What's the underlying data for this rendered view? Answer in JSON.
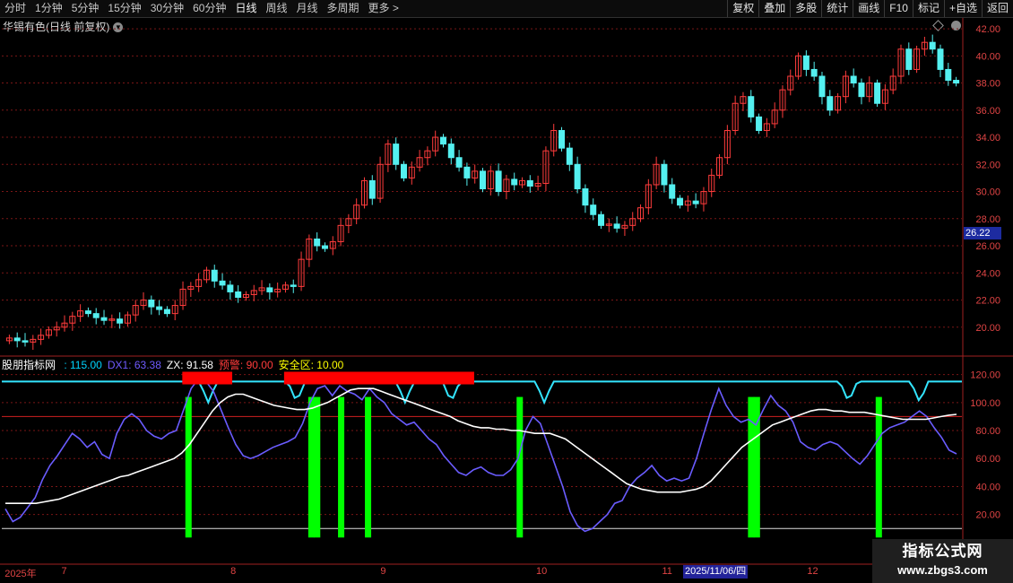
{
  "toolbar": {
    "periods": [
      "分时",
      "1分钟",
      "5分钟",
      "15分钟",
      "30分钟",
      "60分钟",
      "日线",
      "周线",
      "月线",
      "多周期",
      "更多 >"
    ],
    "active_period": "日线",
    "actions": [
      "复权",
      "叠加",
      "多股",
      "统计",
      "画线",
      "F10",
      "标记",
      "+自选",
      "返回"
    ]
  },
  "main": {
    "title": "华锡有色(日线 前复权)",
    "price_tag": "26.22"
  },
  "indicator": {
    "name": "股朋指标网",
    "fields": [
      {
        "label": ": 115.00",
        "color": "#00d4ff"
      },
      {
        "label": "DX1: 63.38",
        "color": "#6f5bff"
      },
      {
        "label": "ZX: 91.58",
        "color": "#ffffff"
      },
      {
        "label": "预警: 90.00",
        "color": "#ff3b3b"
      },
      {
        "label": "安全区: 10.00",
        "color": "#ffff00"
      }
    ]
  },
  "dates": {
    "labels": [
      {
        "text": "2025年",
        "pos": 0.003
      },
      {
        "text": "7",
        "pos": 0.062
      },
      {
        "text": "8",
        "pos": 0.238
      },
      {
        "text": "9",
        "pos": 0.394
      },
      {
        "text": "10",
        "pos": 0.556
      },
      {
        "text": "11",
        "pos": 0.687
      },
      {
        "text": "12",
        "pos": 0.838
      }
    ],
    "cursor_date": "2025/11/06/四"
  },
  "watermark": {
    "title": "指标公式网",
    "url": "www.zbgs3.com"
  },
  "colors": {
    "up": "#ff3c3c",
    "down": "#54f0f0",
    "dx1": "#6a5cff",
    "zx": "#ffffff",
    "line115": "#33e5ff",
    "signal": "#00ff00",
    "alert": "#ff0000"
  },
  "chart_data": [
    {
      "type": "candlestick",
      "title": "华锡有色(日线 前复权)",
      "y_ticks": [
        20.0,
        22.0,
        24.0,
        26.0,
        28.0,
        30.0,
        32.0,
        34.0,
        36.0,
        38.0,
        40.0,
        42.0
      ],
      "ylim": [
        18.0,
        42.6
      ],
      "close": [
        19.2,
        19.0,
        18.9,
        19.1,
        19.4,
        19.8,
        20.0,
        20.3,
        20.8,
        21.2,
        21.0,
        20.7,
        20.5,
        20.6,
        20.3,
        20.9,
        21.6,
        22.0,
        21.5,
        21.3,
        21.0,
        21.6,
        22.8,
        23.0,
        23.5,
        24.2,
        23.4,
        23.1,
        22.6,
        22.2,
        22.4,
        22.7,
        22.9,
        22.6,
        22.8,
        23.1,
        23.0,
        25.0,
        26.5,
        26.0,
        25.8,
        26.3,
        27.5,
        28.0,
        29.0,
        30.8,
        29.5,
        32.0,
        33.5,
        32.0,
        31.0,
        31.8,
        32.5,
        33.0,
        34.0,
        33.5,
        32.5,
        31.8,
        31.0,
        31.5,
        30.2,
        31.5,
        30.0,
        30.9,
        30.5,
        30.8,
        30.4,
        30.6,
        33.0,
        34.5,
        33.2,
        32.0,
        30.2,
        29.0,
        28.3,
        27.5,
        27.6,
        27.3,
        27.5,
        28.0,
        28.8,
        30.5,
        32.0,
        30.5,
        29.5,
        29.0,
        29.3,
        29.1,
        30.0,
        31.2,
        32.5,
        34.5,
        36.5,
        37.0,
        35.5,
        34.5,
        35.0,
        36.0,
        37.5,
        38.5,
        40.0,
        39.0,
        38.5,
        37.0,
        36.0,
        37.0,
        38.5,
        38.0,
        37.0,
        38.0,
        36.5,
        37.5,
        38.5,
        40.5,
        39.0,
        40.5,
        41.0,
        40.5,
        39.0,
        38.2,
        38.0
      ]
    },
    {
      "type": "line",
      "title": "股朋指标网",
      "y_ticks": [
        20.0,
        40.0,
        60.0,
        80.0,
        100.0,
        120.0
      ],
      "ylim": [
        -2,
        130
      ],
      "series": [
        {
          "name": "DX1",
          "values": [
            24,
            15,
            18,
            25,
            32,
            45,
            55,
            62,
            70,
            78,
            74,
            68,
            72,
            63,
            60,
            78,
            88,
            92,
            88,
            80,
            76,
            74,
            78,
            80,
            95,
            110,
            117,
            115,
            108,
            95,
            82,
            70,
            62,
            60,
            62,
            65,
            68,
            70,
            72,
            75,
            85,
            100,
            110,
            112,
            105,
            112,
            108,
            106,
            102,
            110,
            104,
            100,
            92,
            88,
            84,
            86,
            80,
            74,
            70,
            62,
            56,
            50,
            48,
            52,
            54,
            50,
            48,
            48,
            52,
            60,
            80,
            90,
            85,
            70,
            55,
            40,
            22,
            12,
            8,
            10,
            15,
            20,
            28,
            30,
            40,
            46,
            50,
            55,
            48,
            44,
            46,
            44,
            46,
            60,
            78,
            95,
            110,
            98,
            90,
            86,
            88,
            84,
            95,
            105,
            98,
            94,
            86,
            72,
            68,
            66,
            70,
            72,
            70,
            65,
            60,
            56,
            62,
            70,
            78,
            82,
            84,
            86,
            90,
            94,
            90,
            82,
            75,
            66,
            63.38
          ]
        },
        {
          "name": "ZX",
          "values": [
            28,
            28,
            28,
            28,
            28,
            29,
            30,
            31,
            33,
            35,
            37,
            39,
            41,
            43,
            45,
            47,
            48,
            50,
            52,
            54,
            56,
            58,
            60,
            64,
            70,
            78,
            86,
            94,
            100,
            104,
            106,
            106,
            104,
            102,
            100,
            98,
            97,
            96,
            95,
            95,
            96,
            98,
            100,
            103,
            106,
            109,
            110,
            110,
            110,
            108,
            106,
            104,
            102,
            100,
            98,
            96,
            94,
            92,
            90,
            87,
            85,
            83,
            82,
            82,
            81,
            81,
            80,
            80,
            79,
            78,
            78,
            78,
            76,
            74,
            70,
            66,
            62,
            58,
            54,
            50,
            46,
            42,
            40,
            38,
            37,
            36,
            36,
            36,
            36,
            37,
            38,
            40,
            44,
            50,
            56,
            62,
            68,
            72,
            76,
            80,
            84,
            86,
            88,
            90,
            92,
            94,
            95,
            95,
            94,
            94,
            93,
            93,
            93,
            92,
            91,
            90,
            89,
            88,
            88,
            88,
            88,
            89,
            90,
            91,
            91.58
          ]
        }
      ],
      "constants": {
        "top": 115,
        "warn": 90,
        "safe": 10
      },
      "signal_bars": [
        0.194,
        0.322,
        0.328,
        0.353,
        0.381,
        0.539,
        0.78,
        0.786,
        0.913
      ],
      "alert_boxes": [
        [
          0.188,
          0.24
        ],
        [
          0.294,
          0.492
        ]
      ]
    }
  ]
}
